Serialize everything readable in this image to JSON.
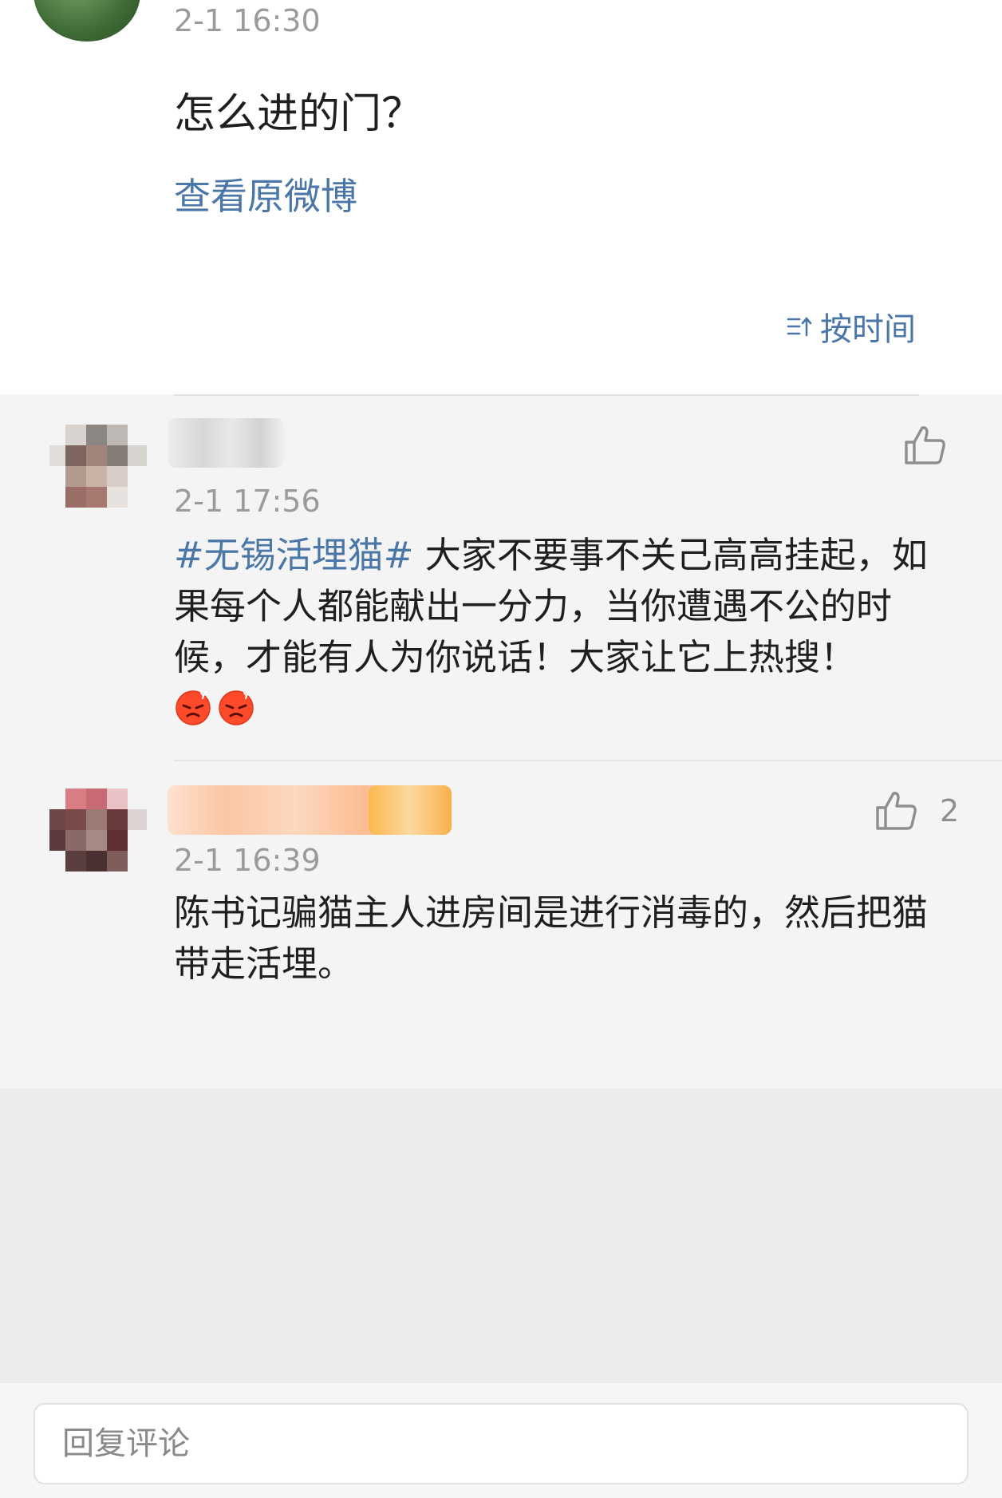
{
  "top_post": {
    "time": "2-1 16:30",
    "text": "怎么进的门？",
    "view_original": "查看原微博"
  },
  "sort": {
    "label": "按时间"
  },
  "comments": [
    {
      "time": "2-1 17:56",
      "time_visible": "2-1 17:56",
      "hashtag": "#无锡活埋猫#",
      "text": " 大家不要事不关己高高挂起，如果每个人都能献出一分力，当你遭遇不公的时候，才能有人为你说话！大家让它上热搜！",
      "like_count": "",
      "emoji": [
        "angry-face-icon",
        "angry-face-icon"
      ]
    },
    {
      "time": "2-1 16:39",
      "text": "陈书记骗猫主人进房间是进行消毒的，然后把猫带走活埋。",
      "like_count": "2"
    }
  ],
  "reply": {
    "placeholder": "回复评论"
  },
  "colors": {
    "link": "#4a76a8",
    "time": "#9b9b9b",
    "text": "#1f1f1f"
  }
}
